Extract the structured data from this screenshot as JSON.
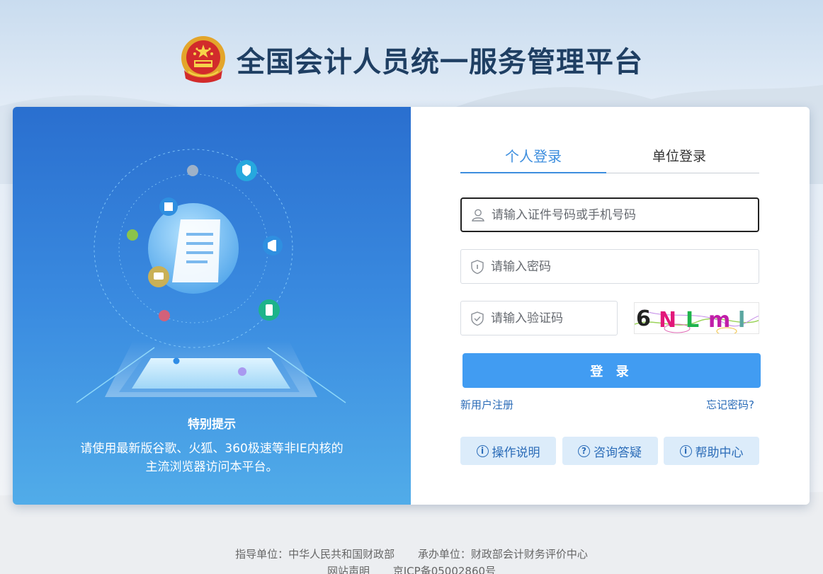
{
  "header": {
    "title": "全国会计人员统一服务管理平台",
    "emblem_icon": "national-emblem-icon"
  },
  "left_panel": {
    "notice_title": "特别提示",
    "notice_lines": [
      "请使用最新版谷歌、火狐、360极速等非IE内核的",
      "主流浏览器访问本平台。"
    ]
  },
  "login": {
    "tabs": [
      {
        "label": "个人登录",
        "active": true
      },
      {
        "label": "单位登录",
        "active": false
      }
    ],
    "username_placeholder": "请输入证件号码或手机号码",
    "password_placeholder": "请输入密码",
    "captcha_placeholder": "请输入验证码",
    "captcha_text": "6NLml",
    "submit_label": "登 录",
    "register_link": "新用户注册",
    "forgot_link": "忘记密码?",
    "help_buttons": [
      {
        "label": "操作说明",
        "icon": "info-icon"
      },
      {
        "label": "咨询答疑",
        "icon": "question-icon"
      },
      {
        "label": "帮助中心",
        "icon": "info-icon"
      }
    ]
  },
  "footer": {
    "guide_unit": "指导单位：中华人民共和国财政部",
    "host_unit": "承办单位：财政部会计财务评价中心",
    "statement": "网站声明",
    "icp": "京ICP备05002860号"
  },
  "colors": {
    "primary": "#419cf2",
    "title": "#1f3f63",
    "link": "#2b6cb8",
    "panel_top": "#2a6fcf",
    "panel_bottom": "#51ace9"
  }
}
